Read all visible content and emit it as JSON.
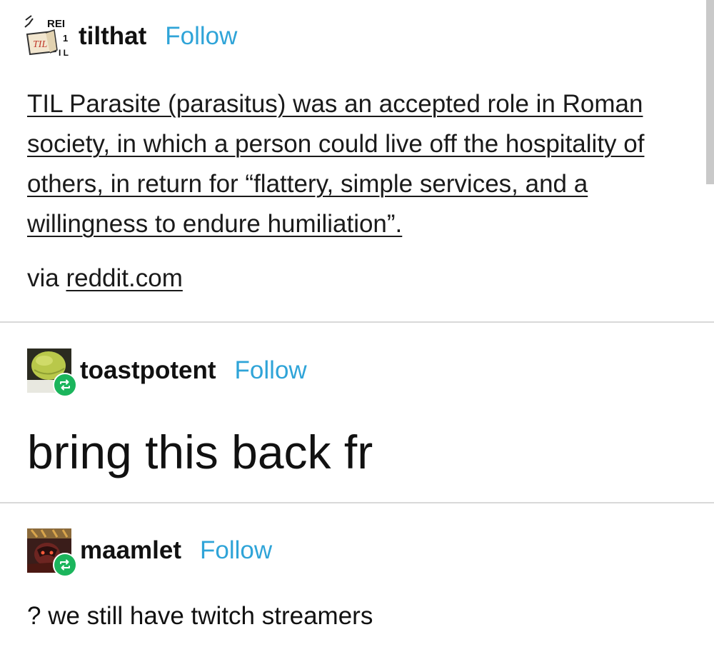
{
  "posts": [
    {
      "username": "tilthat",
      "follow_label": "Follow",
      "avatar_text": {
        "top": "REI",
        "middle": "TIL",
        "side": "1",
        "bottom": "I L"
      },
      "body_text": "TIL Parasite (parasitus) was an accepted role in Roman society, in which a person could live off the hospitality of others, in return for “flattery, simple services, and a willingness to endure humiliation”.",
      "via_prefix": "via ",
      "via_link": "reddit.com"
    },
    {
      "username": "toastpotent",
      "follow_label": "Follow",
      "body_text": "bring this back fr"
    },
    {
      "username": "maamlet",
      "follow_label": "Follow",
      "body_text": "? we still have twitch streamers"
    }
  ],
  "colors": {
    "follow": "#2fa4d8",
    "reblog_badge": "#1bb55c",
    "divider": "#d9d9d9"
  },
  "icons": {
    "reblog": "reblog-icon"
  }
}
